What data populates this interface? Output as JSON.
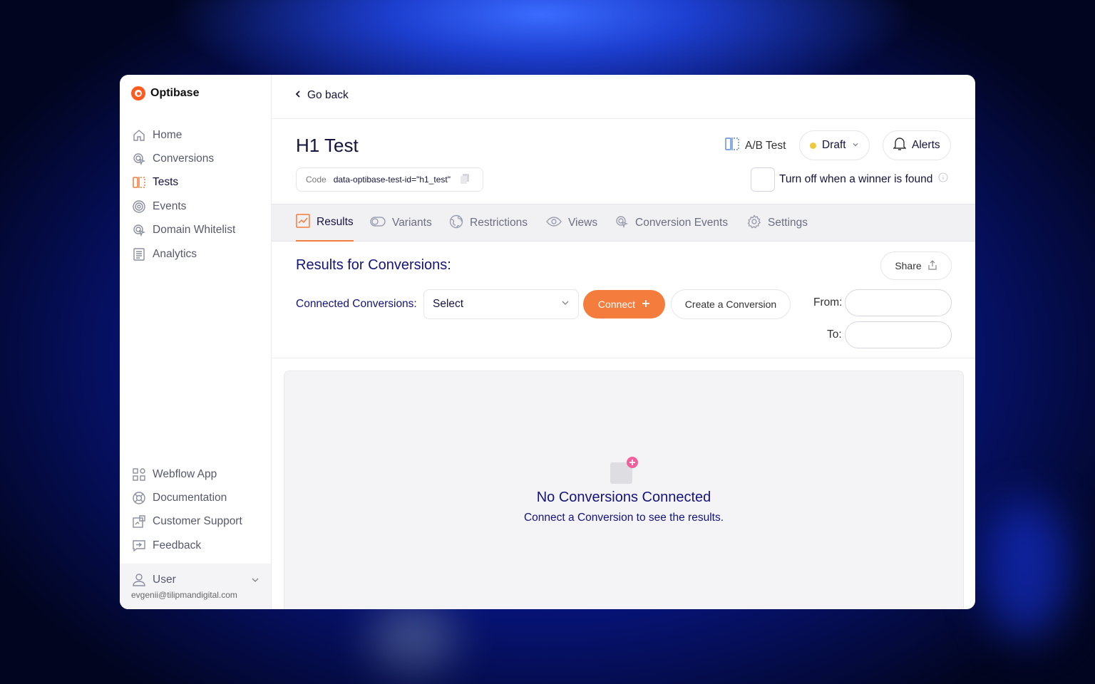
{
  "brand": {
    "name": "Optibase",
    "accent": "#f47c3c"
  },
  "sidebar": {
    "items": [
      {
        "label": "Home",
        "icon": "home-icon"
      },
      {
        "label": "Conversions",
        "icon": "cursor-click-icon"
      },
      {
        "label": "Tests",
        "icon": "split-icon",
        "active": true
      },
      {
        "label": "Events",
        "icon": "target-icon"
      },
      {
        "label": "Domain Whitelist",
        "icon": "cursor-click-icon"
      },
      {
        "label": "Analytics",
        "icon": "document-icon"
      }
    ],
    "bottom_items": [
      {
        "label": "Webflow App",
        "icon": "grid-icon"
      },
      {
        "label": "Documentation",
        "icon": "lifebuoy-icon"
      },
      {
        "label": "Customer Support",
        "icon": "support-icon"
      },
      {
        "label": "Feedback",
        "icon": "feedback-icon"
      }
    ],
    "user": {
      "name": "User",
      "email": "evgenii@tilipmandigital.com"
    }
  },
  "header": {
    "go_back": "Go back",
    "title": "H1 Test",
    "code_label": "Code",
    "code_value": "data-optibase-test-id=\"h1_test\"",
    "test_type": "A/B Test",
    "status": "Draft",
    "alerts": "Alerts",
    "turn_off_label": "Turn off when a winner is found"
  },
  "tabs": [
    {
      "label": "Results",
      "icon": "chart-icon",
      "active": true
    },
    {
      "label": "Variants",
      "icon": "toggle-icon"
    },
    {
      "label": "Restrictions",
      "icon": "globe-icon"
    },
    {
      "label": "Views",
      "icon": "eye-icon"
    },
    {
      "label": "Conversion Events",
      "icon": "cursor-click-icon"
    },
    {
      "label": "Settings",
      "icon": "gear-icon"
    }
  ],
  "results": {
    "title": "Results for Conversions:",
    "share": "Share",
    "connected_label": "Connected Conversions:",
    "select_value": "Select",
    "connect_button": "Connect",
    "create_button": "Create a Conversion",
    "from_label": "From:",
    "to_label": "To:",
    "empty_title": "No Conversions Connected",
    "empty_sub": "Connect a Conversion to see the results."
  }
}
